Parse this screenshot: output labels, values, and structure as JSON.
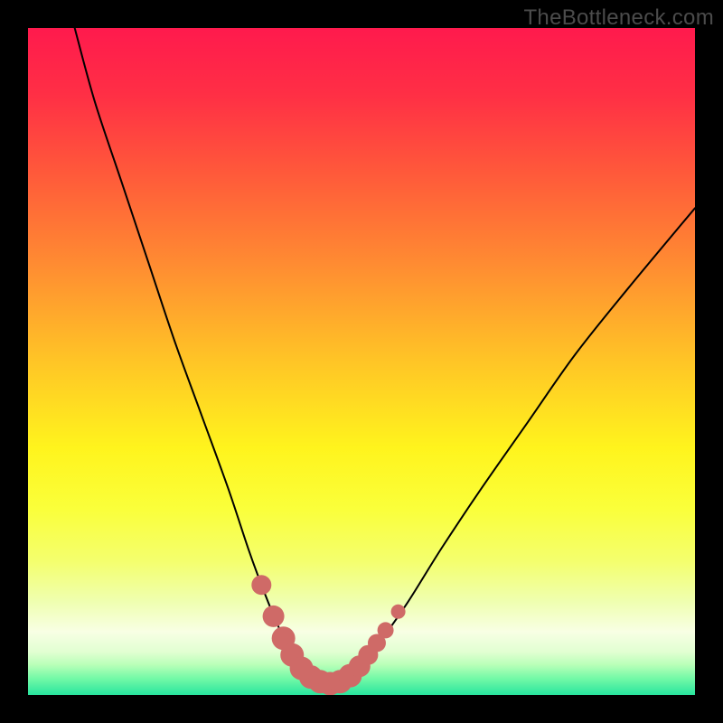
{
  "watermark_text": "TheBottleneck.com",
  "colors": {
    "frame": "#000000",
    "gradient_stops": [
      {
        "offset": 0.0,
        "color": "#ff1a4d"
      },
      {
        "offset": 0.1,
        "color": "#ff2f45"
      },
      {
        "offset": 0.22,
        "color": "#ff5a3a"
      },
      {
        "offset": 0.35,
        "color": "#ff8a32"
      },
      {
        "offset": 0.5,
        "color": "#ffc526"
      },
      {
        "offset": 0.63,
        "color": "#fff41d"
      },
      {
        "offset": 0.72,
        "color": "#faff3a"
      },
      {
        "offset": 0.8,
        "color": "#f4ff6e"
      },
      {
        "offset": 0.86,
        "color": "#efffb0"
      },
      {
        "offset": 0.905,
        "color": "#f8ffe4"
      },
      {
        "offset": 0.935,
        "color": "#e2ffd2"
      },
      {
        "offset": 0.955,
        "color": "#b8ffb8"
      },
      {
        "offset": 0.975,
        "color": "#74f9a7"
      },
      {
        "offset": 1.0,
        "color": "#28e59e"
      }
    ],
    "curve": "#000000",
    "marker_fill": "#cf6a67",
    "marker_stroke": "#cf6a67"
  },
  "chart_data": {
    "type": "line",
    "title": "",
    "xlabel": "",
    "ylabel": "",
    "xlim": [
      0,
      100
    ],
    "ylim": [
      0,
      100
    ],
    "grid": false,
    "series": [
      {
        "name": "bottleneck-curve",
        "x": [
          7,
          10,
          14,
          18,
          22,
          26,
          30,
          33,
          35,
          37,
          38.5,
          40,
          41.5,
          43,
          44.5,
          46,
          48,
          50,
          53,
          57,
          62,
          68,
          75,
          82,
          90,
          100
        ],
        "y": [
          100,
          89,
          77,
          65,
          53,
          42,
          31,
          22,
          16.5,
          11.5,
          8.2,
          5.4,
          3.5,
          2.3,
          1.6,
          1.7,
          2.5,
          4.5,
          8.3,
          14,
          22,
          31,
          41,
          51,
          61,
          73
        ]
      }
    ],
    "markers": [
      {
        "x": 35.0,
        "y": 16.5,
        "r": 11
      },
      {
        "x": 36.8,
        "y": 11.8,
        "r": 12
      },
      {
        "x": 38.3,
        "y": 8.5,
        "r": 13
      },
      {
        "x": 39.6,
        "y": 6.0,
        "r": 13
      },
      {
        "x": 41.0,
        "y": 4.0,
        "r": 13
      },
      {
        "x": 42.4,
        "y": 2.7,
        "r": 13
      },
      {
        "x": 43.8,
        "y": 2.0,
        "r": 13
      },
      {
        "x": 45.3,
        "y": 1.7,
        "r": 13
      },
      {
        "x": 46.8,
        "y": 2.0,
        "r": 13
      },
      {
        "x": 48.3,
        "y": 2.9,
        "r": 13
      },
      {
        "x": 49.7,
        "y": 4.3,
        "r": 12
      },
      {
        "x": 51.0,
        "y": 6.0,
        "r": 11
      },
      {
        "x": 52.3,
        "y": 7.8,
        "r": 10
      },
      {
        "x": 53.6,
        "y": 9.7,
        "r": 9
      },
      {
        "x": 55.5,
        "y": 12.5,
        "r": 8
      }
    ]
  }
}
